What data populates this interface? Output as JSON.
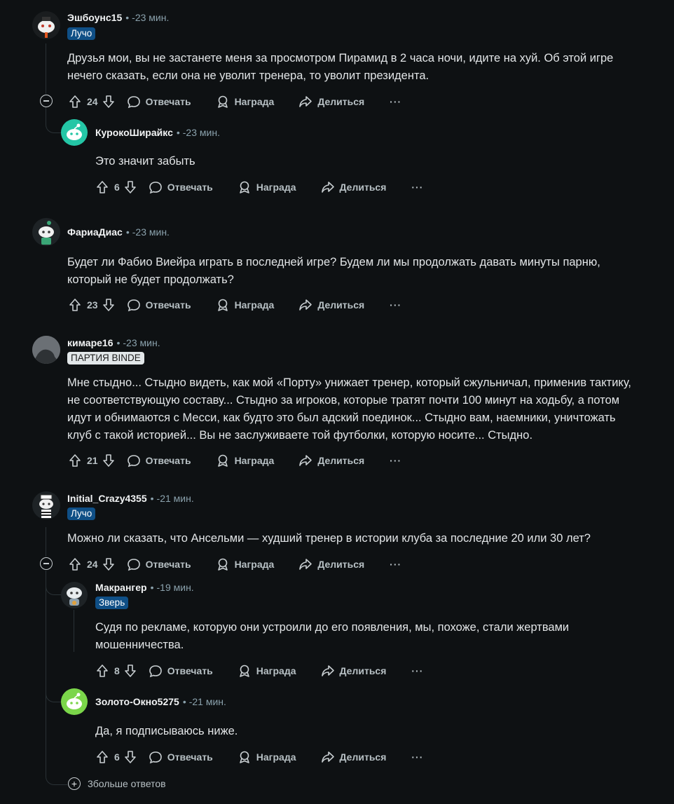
{
  "ui": {
    "reply_label": "Отвечать",
    "award_label": "Награда",
    "share_label": "Делиться",
    "more_label": "···",
    "time_separator": "•"
  },
  "comments": [
    {
      "author": "Эшбоунс15",
      "time": "-23 мин.",
      "flair": "Лучо",
      "body": [
        "Друзья мои, вы не застанете меня за просмотром Пирамид в 2 часа ночи, идите на хуй. Об этой игре",
        "нечего сказать, если она не уволит тренера, то уволит президента."
      ],
      "votes": "24",
      "replies": [
        {
          "author": "КурокоШирайкс",
          "time": "-23 мин.",
          "body": [
            "Это значит забыть"
          ],
          "votes": "6"
        }
      ]
    },
    {
      "author": "ФариаДиас",
      "time": "-23 мин.",
      "body": [
        "Будет ли Фабио Виейра играть в последней игре? Будем ли мы продолжать давать минуты парню,",
        "который не будет продолжать?"
      ],
      "votes": "23"
    },
    {
      "author": "кимаре16",
      "time": "-23 мин.",
      "flair": "ПАРТИЯ BINDE",
      "body": [
        "Мне стыдно... Стыдно видеть, как мой «Порту» унижает тренер, который сжульничал, применив тактику,",
        "не соответствующую составу... Стыдно за игроков, которые тратят почти 100 минут на ходьбу, а потом",
        "идут и обнимаются с Месси, как будто это был адский поединок... Стыдно вам, наемники, уничтожать",
        "клуб с такой историей... Вы не заслуживаете той футболки, которую носите... Стыдно."
      ],
      "votes": "21"
    },
    {
      "author": "Initial_Crazy4355",
      "time": "-21 мин.",
      "flair": "Лучо",
      "body": [
        "Можно ли сказать, что Ансельми — худший тренер в истории клуба за последние 20 или 30 лет?"
      ],
      "votes": "24",
      "replies": [
        {
          "author": "Макрангер",
          "time": "-19 мин.",
          "flair": "Зверь",
          "body": [
            "Судя по рекламе, которую они устроили до его появления, мы, похоже, стали жертвами",
            "мошенничества."
          ],
          "votes": "8"
        },
        {
          "author": "Золото-Окно5275",
          "time": "-21 мин.",
          "body": [
            "Да, я подписываюсь ниже."
          ],
          "votes": "6"
        }
      ],
      "more_replies": "3больше ответов"
    }
  ],
  "colors": {
    "background": "#0e1113",
    "flair_blue": "#0f4f86",
    "flair_gray": "#e2e7e9",
    "thread_line": "#2a3236"
  }
}
